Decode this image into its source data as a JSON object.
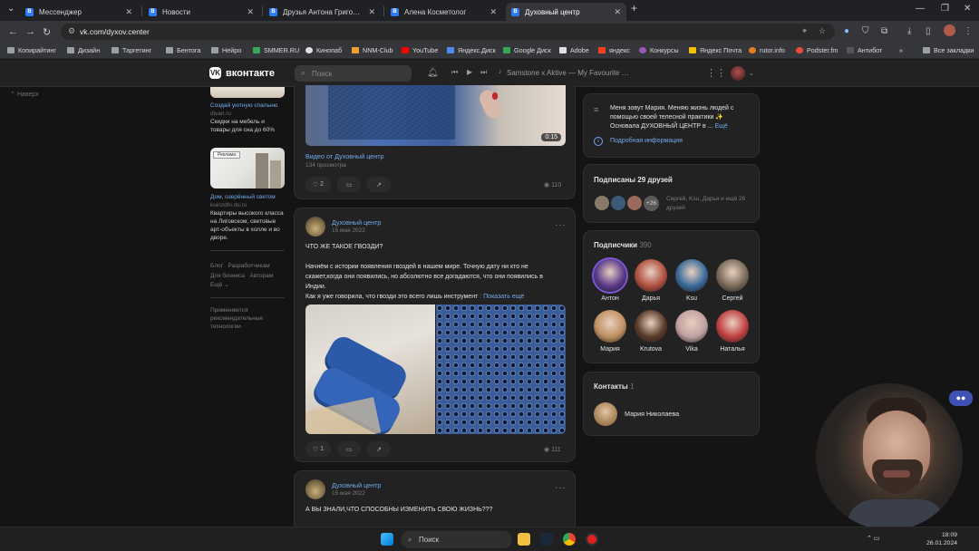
{
  "browser": {
    "tabs": [
      {
        "label": "Мессенджер",
        "color": "#2d7cf6"
      },
      {
        "label": "Новости",
        "color": "#2d7cf6"
      },
      {
        "label": "Друзья Антона Григорьева – ВКонтакте",
        "color": "#2d7cf6"
      },
      {
        "label": "Алена Косметолог",
        "color": "#2d7cf6"
      },
      {
        "label": "Духовный центр",
        "color": "#2d7cf6"
      }
    ],
    "url": "vk.com/dyxov.center",
    "bookmarks": [
      {
        "label": "Копирайтинг",
        "color": "#9aa0a6"
      },
      {
        "label": "Дизайн",
        "color": "#9aa0a6"
      },
      {
        "label": "Таргетинг",
        "color": "#9aa0a6"
      },
      {
        "label": "Бентога",
        "color": "#9aa0a6"
      },
      {
        "label": "Нейро",
        "color": "#9aa0a6"
      },
      {
        "label": "SMMER.RU",
        "color": "#3aa757"
      },
      {
        "label": "Кинопаб",
        "color": "#e0e0e0"
      },
      {
        "label": "NNM-Club",
        "color": "#f0a030"
      },
      {
        "label": "YouTube",
        "color": "#ff0000"
      },
      {
        "label": "Яндекс.Диск",
        "color": "#4a8cf0"
      },
      {
        "label": "Google Диск",
        "color": "#34a853"
      },
      {
        "label": "Adobe",
        "color": "#e0e0e0"
      },
      {
        "label": "яндекс",
        "color": "#fc3f1d"
      },
      {
        "label": "Конкурсы",
        "color": "#9b59b6"
      },
      {
        "label": "Яндекс Почта",
        "color": "#f5c000"
      },
      {
        "label": "rutor.info",
        "color": "#e67e22"
      },
      {
        "label": "Podster.fm",
        "color": "#e74c3c"
      },
      {
        "label": "Антибот",
        "color": "#555555"
      }
    ],
    "bookmarks_more": "»",
    "all_bookmarks": "Все закладки"
  },
  "vk": {
    "logo": "вконтакте",
    "search_placeholder": "Поиск",
    "player": "Samstone x Aktive — My Favourite Ga..."
  },
  "left": {
    "back": "Наверх",
    "ad1": {
      "title": "Создай уютную спальню",
      "domain": "divan.ru",
      "desc": "Скидки на мебель и товары для сна до 60%"
    },
    "ad2": {
      "title": "Дом, озерённый светом",
      "domain": "kuinzdhi.rbi.ru",
      "desc": "Квартиры высокого класса на Лиговском, световые арт-объекты в холле и во дворе.",
      "badge": "Реклама"
    },
    "links": {
      "blog": "Блог",
      "devs": "Разработчикам",
      "business": "Для бизнеса",
      "authors": "Авторам",
      "more": "Ещё ⌄"
    },
    "recommend": "Применяются рекомендательные технологии"
  },
  "posts": [
    {
      "video_caption": "Видео от Духовный центр",
      "views_line": "134 просмотра",
      "duration": "0:15",
      "likes": "2",
      "views": "110"
    },
    {
      "author": "Духовный центр",
      "date": "15 мая 2022",
      "line1": "ЧТО ЖЕ ТАКОЕ ГВОЗДИ?",
      "line2": "Начнём с истории появления гвоздей в нашем мире. Точную дату ни кто не",
      "line3": "скажет,когда они появились, но абсолютно все догадаются, что они появились в",
      "line4": "Индии.",
      "line5": "Как я уже говорила, что гвозди это всего лишь инструмент",
      "more": "Показать ещё",
      "likes": "1",
      "views": "111"
    },
    {
      "author": "Духовный центр",
      "date": "15 мая 2022",
      "line1": "А ВЫ ЗНАЛИ,ЧТО СПОСОБНЫ ИЗМЕНИТЬ СВОЮ ЖИЗНЬ???"
    }
  ],
  "right": {
    "about": "Меня зовут Мария. Меняю жизнь людей с помощью своей телесной практики ✨ Основала ДУХОВНЫЙ ЦЕНТР в ...",
    "about_more": "Ещё",
    "details": "Подробная информация",
    "friends_title": "Подписаны 29 друзей",
    "friends_more": "+26",
    "friends_names": "Сергей, Ksu, Дарья и ещё 26 друзей",
    "subs_title": "Подписчики",
    "subs_count": "390",
    "subs": [
      {
        "name": "Антон",
        "color": "#5b3a8a"
      },
      {
        "name": "Дарья",
        "color": "#b05040"
      },
      {
        "name": "Ksu",
        "color": "#3a6a9a"
      },
      {
        "name": "Сергей",
        "color": "#7a6a5a"
      },
      {
        "name": "Мария",
        "color": "#c09060"
      },
      {
        "name": "Krutova",
        "color": "#5a3a2a"
      },
      {
        "name": "Vika",
        "color": "#c0a0a0"
      },
      {
        "name": "Наталья",
        "color": "#c04040"
      }
    ],
    "contacts_title": "Контакты",
    "contacts_count": "1",
    "contact_name": "Мария Николаева"
  },
  "taskbar": {
    "search": "Поиск",
    "time": "18:09",
    "date": "26.01.2024"
  }
}
